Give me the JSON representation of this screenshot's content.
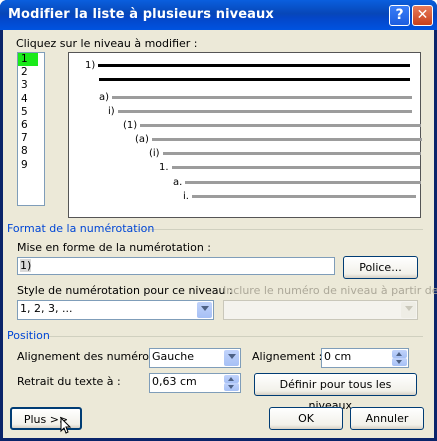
{
  "dialog": {
    "title": "Modifier la liste à plusieurs niveaux",
    "help_glyph": "?",
    "close_glyph": "✕"
  },
  "level_select": {
    "prompt": "Cliquez sur le niveau à modifier :",
    "levels": [
      "1",
      "2",
      "3",
      "4",
      "5",
      "6",
      "7",
      "8",
      "9"
    ],
    "selected": "1"
  },
  "preview": {
    "labels": [
      "1)",
      "a)",
      "i)",
      "(1)",
      "(a)",
      "(i)",
      "1.",
      "a.",
      "i."
    ]
  },
  "format_section": {
    "header": "Format de la numérotation",
    "format_label": "Mise en forme de la numérotation :",
    "format_value": "1)",
    "font_button": "Police...",
    "style_label": "Style de numérotation pour ce niveau :",
    "style_value": "1, 2, 3, ...",
    "include_label": "Inclure le numéro de niveau à partir de :"
  },
  "position_section": {
    "header": "Position",
    "number_align_label": "Alignement des numéros :",
    "number_align_value": "Gauche",
    "align_label": "Alignement :",
    "align_value": "0 cm",
    "indent_label": "Retrait du texte à :",
    "indent_value": "0,63 cm",
    "set_all_button": "Définir pour tous les niveaux..."
  },
  "footer": {
    "more_button": "Plus >>",
    "ok_button": "OK",
    "cancel_button": "Annuler"
  }
}
